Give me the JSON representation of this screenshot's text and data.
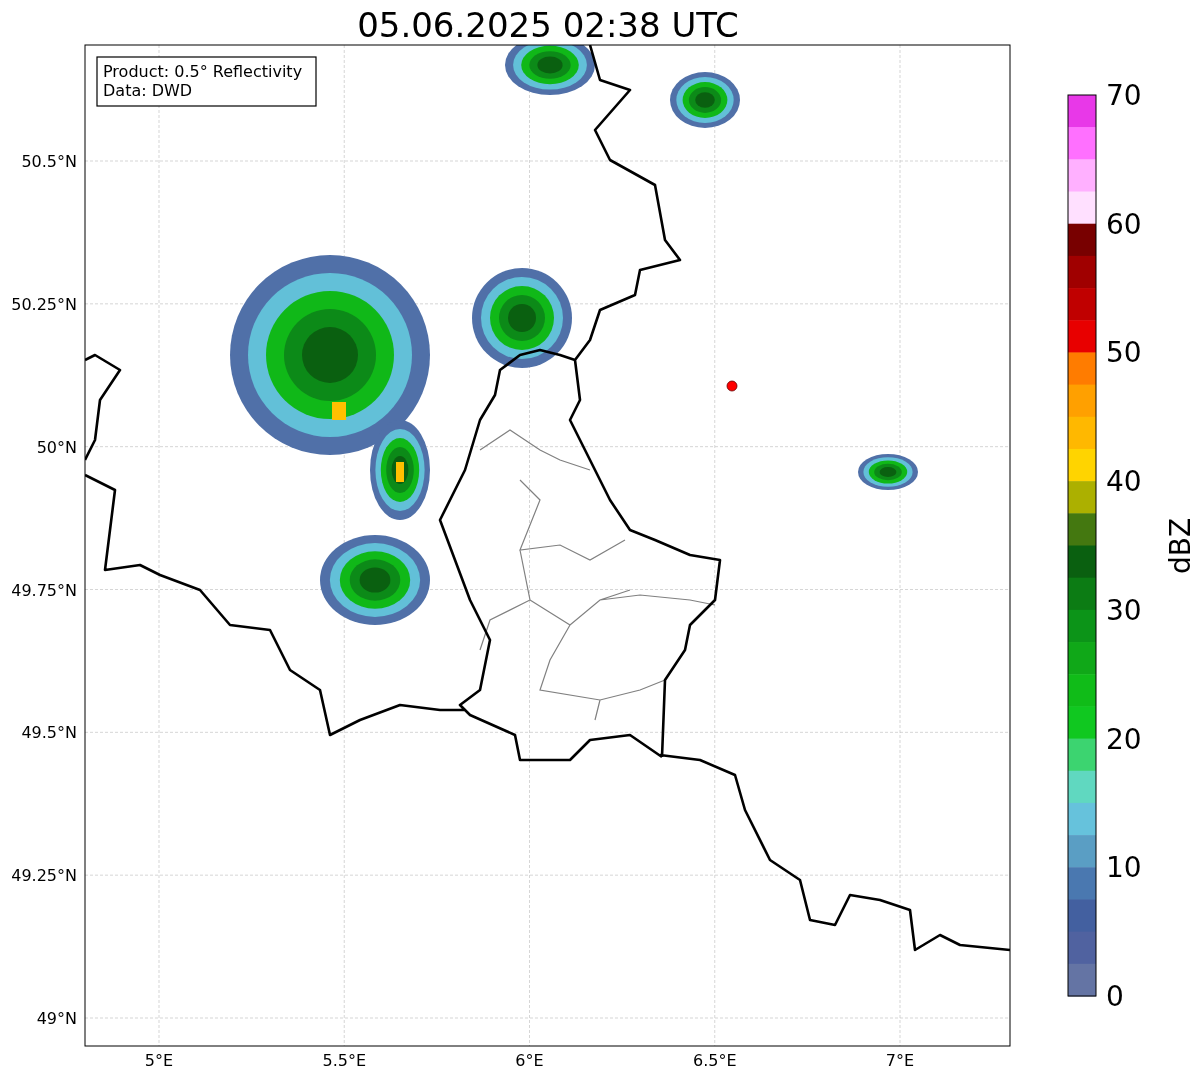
{
  "title": "05.06.2025 02:38 UTC",
  "info_box": {
    "lines": [
      "Product: 0.5° Reflectivity",
      "Data: DWD"
    ]
  },
  "axes": {
    "yticks": [
      "50.5°N",
      "50.25°N",
      "50°N",
      "49.75°N",
      "49.5°N",
      "49.25°N",
      "49°N"
    ],
    "xticks": [
      "5°E",
      "5.5°E",
      "6°E",
      "6.5°E",
      "7°E"
    ]
  },
  "colorbar": {
    "label": "dBZ",
    "ticks": [
      "70",
      "60",
      "50",
      "40",
      "30",
      "20",
      "10",
      "0"
    ],
    "segments": [
      {
        "color": "#e838e8"
      },
      {
        "color": "#ff70ff"
      },
      {
        "color": "#ffb0ff"
      },
      {
        "color": "#ffe0ff"
      },
      {
        "color": "#780000"
      },
      {
        "color": "#a00000"
      },
      {
        "color": "#c00000"
      },
      {
        "color": "#e80000"
      },
      {
        "color": "#ff7c00"
      },
      {
        "color": "#ffa000"
      },
      {
        "color": "#ffb800"
      },
      {
        "color": "#ffd400"
      },
      {
        "color": "#acb000"
      },
      {
        "color": "#447810"
      },
      {
        "color": "#0a6010"
      },
      {
        "color": "#0c7c14"
      },
      {
        "color": "#0c9418"
      },
      {
        "color": "#10a818"
      },
      {
        "color": "#10bc18"
      },
      {
        "color": "#10c820"
      },
      {
        "color": "#3cd470"
      },
      {
        "color": "#60d8c0"
      },
      {
        "color": "#66c2dc"
      },
      {
        "color": "#5a9ec4"
      },
      {
        "color": "#4a78b0"
      },
      {
        "color": "#4360a0"
      },
      {
        "color": "#5062a0"
      },
      {
        "color": "#6474a4"
      }
    ]
  }
}
